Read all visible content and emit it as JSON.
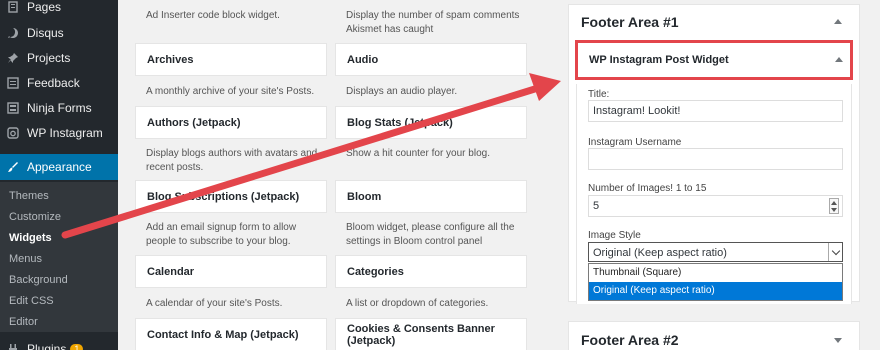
{
  "sidebar": {
    "menu": [
      {
        "label": "Pages",
        "icon": "pages-icon"
      },
      {
        "label": "Disqus",
        "icon": "disqus-icon"
      },
      {
        "label": "Projects",
        "icon": "pin-icon"
      },
      {
        "label": "Feedback",
        "icon": "feedback-icon"
      },
      {
        "label": "Ninja Forms",
        "icon": "forms-icon"
      },
      {
        "label": "WP Instagram",
        "icon": "instagram-icon"
      },
      {
        "label": "Appearance",
        "icon": "paintbrush-icon"
      }
    ],
    "submenu": [
      "Themes",
      "Customize",
      "Widgets",
      "Menus",
      "Background",
      "Edit CSS",
      "Editor"
    ],
    "bottom_item": {
      "label": "Plugins",
      "badge": "1"
    }
  },
  "widgets": {
    "top_desc": [
      "Ad Inserter code block widget.",
      "Display the number of spam comments Akismet has caught"
    ],
    "rows": [
      [
        {
          "title": "Archives",
          "desc": "A monthly archive of your site's Posts."
        },
        {
          "title": "Audio",
          "desc": "Displays an audio player."
        }
      ],
      [
        {
          "title": "Authors (Jetpack)",
          "desc": "Display blogs authors with avatars and recent posts."
        },
        {
          "title": "Blog Stats (Jetpack)",
          "desc": "Show a hit counter for your blog."
        }
      ],
      [
        {
          "title": "Blog Subscriptions (Jetpack)",
          "desc": "Add an email signup form to allow people to subscribe to your blog."
        },
        {
          "title": "Bloom",
          "desc": "Bloom widget, please configure all the settings in Bloom control panel"
        }
      ],
      [
        {
          "title": "Calendar",
          "desc": "A calendar of your site's Posts."
        },
        {
          "title": "Categories",
          "desc": "A list or dropdown of categories."
        }
      ],
      [
        {
          "title": "Contact Info & Map (Jetpack)",
          "desc": ""
        },
        {
          "title": "Cookies & Consents Banner (Jetpack)",
          "desc": ""
        }
      ]
    ]
  },
  "footer_area_1": {
    "title": "Footer Area #1",
    "widget_title": "WP Instagram Post Widget",
    "fields": {
      "title_label": "Title:",
      "title_value": "Instagram! Lookit!",
      "username_label": "Instagram Username",
      "username_value": "",
      "count_label": "Number of Images! 1 to 15",
      "count_value": "5",
      "style_label": "Image Style",
      "style_value": "Original (Keep aspect ratio)",
      "style_options": [
        "Thumbnail (Square)",
        "Original (Keep aspect ratio)"
      ]
    }
  },
  "footer_area_2": {
    "title": "Footer Area #2"
  },
  "colors": {
    "admin_bar": "#23282d",
    "active": "#0073aa",
    "highlight": "#e3454b",
    "selection": "#0078d7"
  }
}
